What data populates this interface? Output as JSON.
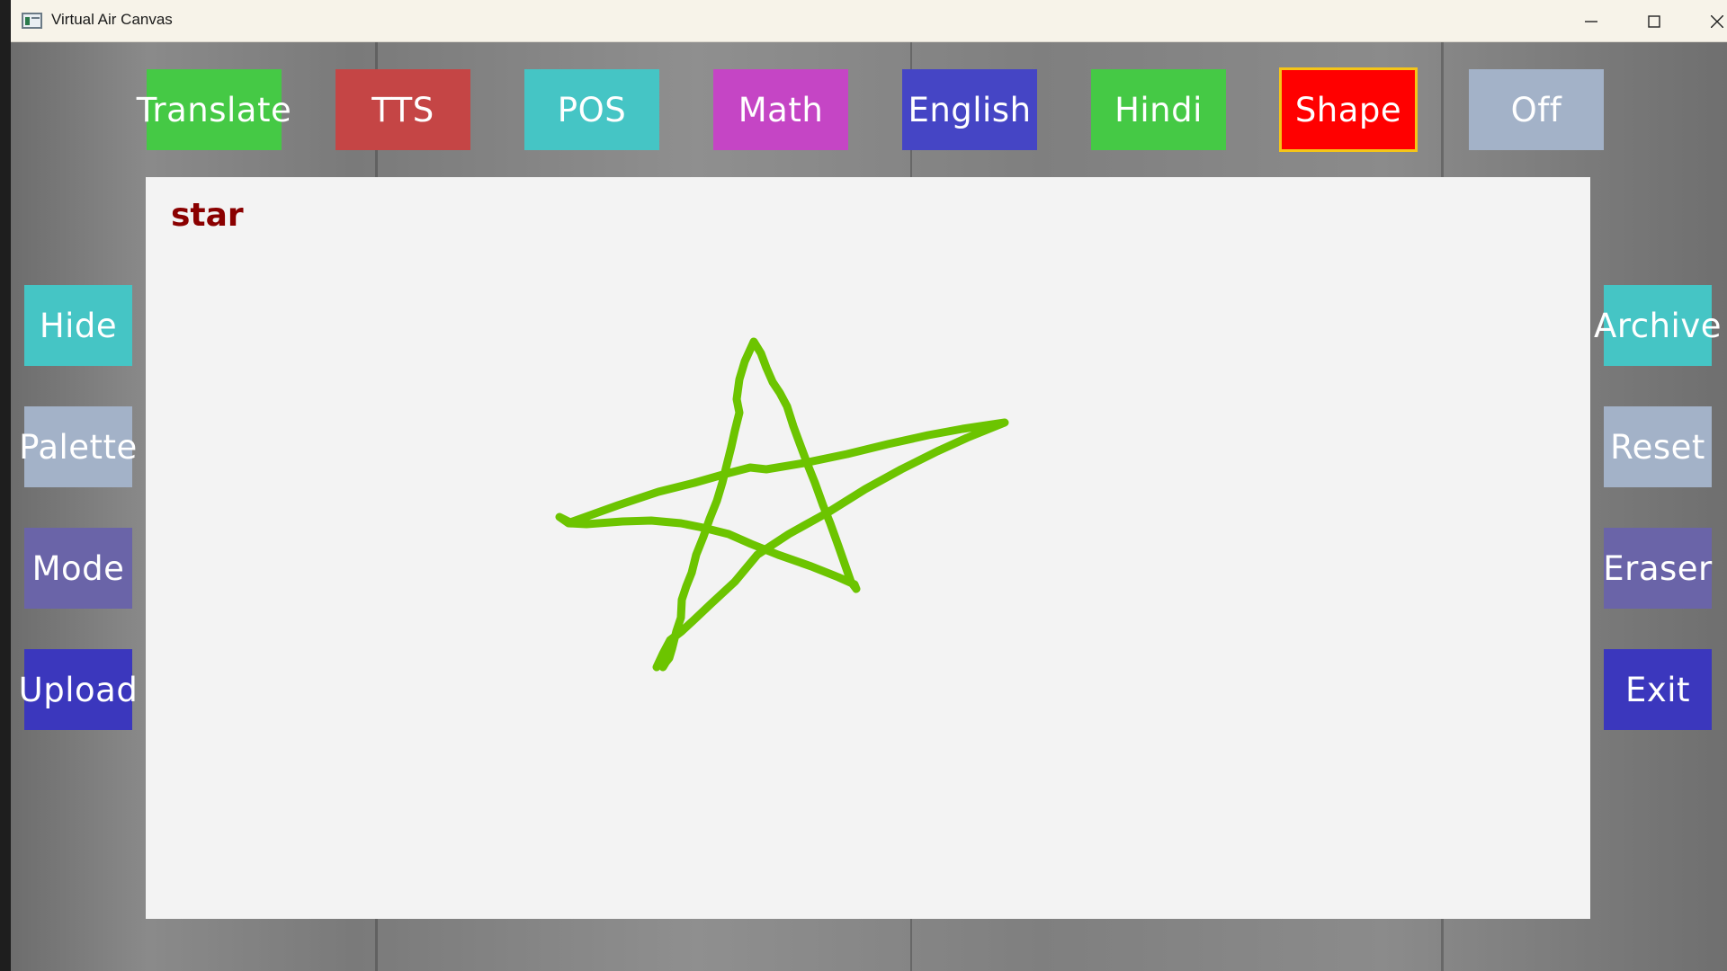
{
  "window": {
    "title": "Virtual Air Canvas"
  },
  "top_buttons": [
    {
      "label": "Translate",
      "color": "#45c945"
    },
    {
      "label": "TTS",
      "color": "#c54545"
    },
    {
      "label": "POS",
      "color": "#45c5c5"
    },
    {
      "label": "Math",
      "color": "#c545c5"
    },
    {
      "label": "English",
      "color": "#4545c5"
    },
    {
      "label": "Hindi",
      "color": "#45c945"
    },
    {
      "label": "Shape",
      "color": "#ff0000",
      "selected": true,
      "border_color": "#f5c518"
    },
    {
      "label": "Off",
      "color": "#a3b2c8"
    }
  ],
  "left_buttons": [
    {
      "label": "Hide",
      "color": "#45c5c5"
    },
    {
      "label": "Palette",
      "color": "#a3b2c8"
    },
    {
      "label": "Mode",
      "color": "#6a64a8"
    },
    {
      "label": "Upload",
      "color": "#3b37bd"
    }
  ],
  "right_buttons": [
    {
      "label": "Archive",
      "color": "#45c5c5"
    },
    {
      "label": "Reset",
      "color": "#a3b2c8"
    },
    {
      "label": "Eraser",
      "color": "#6a64a8"
    },
    {
      "label": "Exit",
      "color": "#3b37bd"
    }
  ],
  "canvas": {
    "recognized_label": "star",
    "label_color": "#8a0000",
    "stroke_color": "#6cc400",
    "drawing_icon": "star-stroke"
  }
}
